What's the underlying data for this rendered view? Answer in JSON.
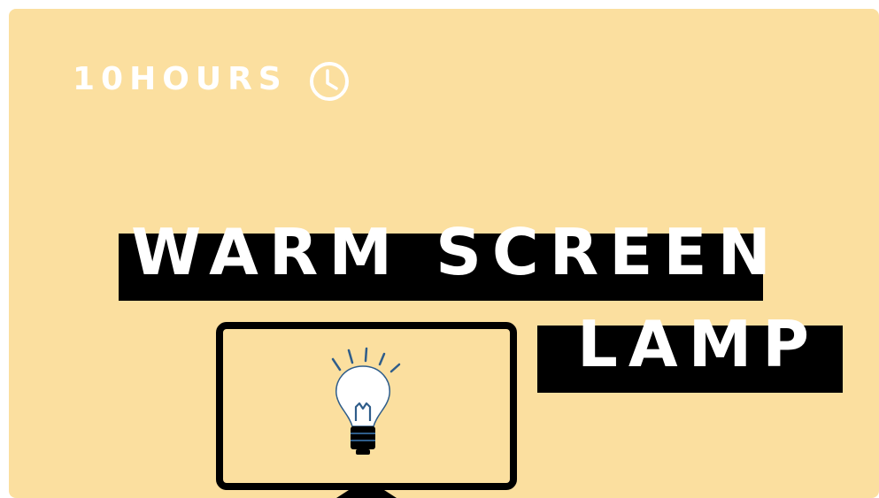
{
  "header": {
    "duration_label": "10HOURS",
    "clock_icon": "clock-icon"
  },
  "title": {
    "line1": "WARM SCREEN",
    "line2": "LAMP"
  },
  "illustration": {
    "monitor_icon": "monitor-icon",
    "bulb_icon": "lightbulb-icon"
  },
  "colors": {
    "background": "#fbdf9f",
    "text": "#ffffff",
    "bar": "#000000",
    "bulb_lines": "#2f5d8a"
  }
}
